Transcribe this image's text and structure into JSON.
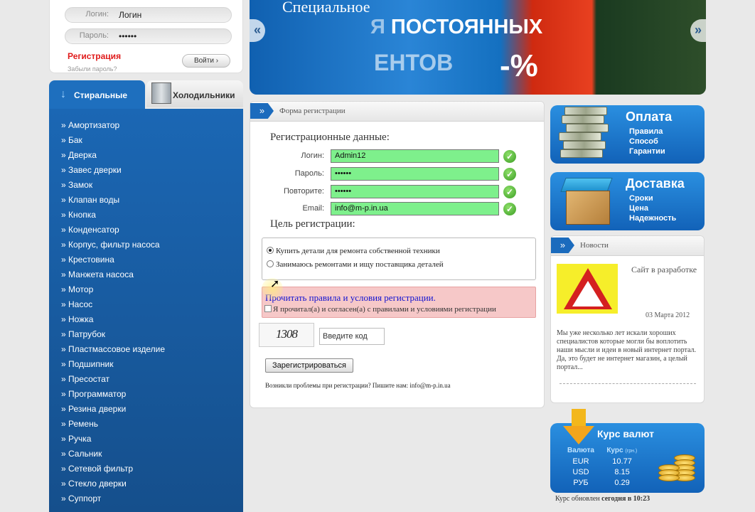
{
  "login": {
    "login_label": "Логин:",
    "login_value": "Логин",
    "password_label": "Пароль:",
    "password_value": "••••••",
    "register_link": "Регистрация",
    "forgot_link": "Забыли пароль?",
    "login_button": "Войти ›"
  },
  "banner": {
    "line1": "Специальное",
    "line2_faded": "Я ",
    "line2_bright": "ПОСТОЯННЫХ",
    "line3": "ЕНТОВ",
    "discount": "-%",
    "prev_icon": "«",
    "next_icon": "»"
  },
  "categories": {
    "tab_washers": "Стиральные",
    "tab_washers_icon": "↓",
    "tab_fridges": "Холодильники",
    "items": [
      "» Амортизатор",
      "» Бак",
      "» Дверка",
      "» Завес дверки",
      "» Замок",
      "» Клапан воды",
      "» Кнопка",
      "» Конденсатор",
      "» Корпус, фильтр насоса",
      "» Крестовина",
      "» Манжета насоса",
      "» Мотор",
      "» Насос",
      "» Ножка",
      "» Патрубок",
      "» Пластмассовое изделие",
      "» Подшипник",
      "» Пресостат",
      "» Программатор",
      "» Резина дверки",
      "» Ремень",
      "» Ручка",
      "» Сальник",
      "» Сетевой фильтр",
      "» Стекло дверки",
      "» Суппорт"
    ]
  },
  "registration": {
    "panel_title": "Форма регистрации",
    "panel_icon": "»",
    "heading": "Регистрационные данные:",
    "fields": [
      {
        "label": "Логин:",
        "value": "Admin12"
      },
      {
        "label": "Пароль:",
        "value": "••••••"
      },
      {
        "label": "Повторите:",
        "value": "••••••"
      },
      {
        "label": "Email:",
        "value": "info@m-p.in.ua"
      }
    ],
    "ok_icon": "✓",
    "goal_heading": "Цель регистрации:",
    "goal_options": [
      {
        "label": "Купить детали для ремонта собственной техники",
        "selected": true
      },
      {
        "label": "Занимаюсь ремонтами и ищу поставщика деталей",
        "selected": false
      }
    ],
    "rules_link": "Прочитать правила и условия регистрации.",
    "rules_checkbox": "Я прочитал(а) и согласен(а) с правилами и условиями регистрации",
    "captcha_text": "1308",
    "captcha_placeholder": "Введите код",
    "submit": "Зарегистрироваться",
    "help": "Возникли проблемы при регистрации? Пишите нам: info@m-p.in.ua"
  },
  "promo_payment": {
    "title": "Оплата",
    "links": [
      "Правила",
      "Способ",
      "Гарантии"
    ]
  },
  "promo_delivery": {
    "title": "Доставка",
    "links": [
      "Сроки",
      "Цена",
      "Надежность"
    ]
  },
  "news": {
    "panel_title": "Новости",
    "panel_icon": "»",
    "item_title": "Сайт в разработке",
    "item_date": "03 Марта 2012",
    "item_text": "Мы уже несколько лет искали хороших специалистов которые могли бы воплотить наши мысли и идеи в новый интернет портал. Да, это будет не интернет магазин, а целый портал..."
  },
  "currency": {
    "title": "Курс валют",
    "col_currency": "Валюта",
    "col_rate": "Курс",
    "col_rate_unit": "(грн.)",
    "rows": [
      {
        "code": "EUR",
        "rate": "10.77"
      },
      {
        "code": "USD",
        "rate": "8.15"
      },
      {
        "code": "РУБ",
        "rate": "0.29"
      }
    ],
    "updated_prefix": "Курс обновлен ",
    "updated_when": "сегодня в 10:23"
  },
  "colors": {
    "brand_blue": "#1b6bbd",
    "field_ok_green": "#7ef08c",
    "register_red": "#e01b1b",
    "rules_bg": "#f6c8c8"
  }
}
